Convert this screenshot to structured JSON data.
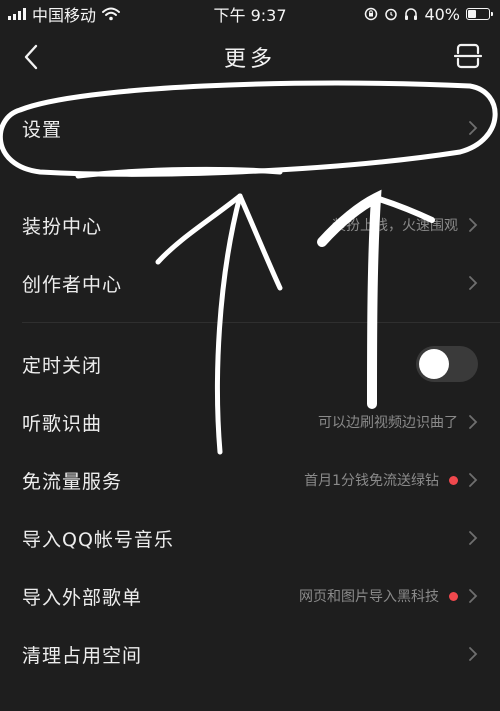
{
  "status_bar": {
    "carrier": "中国移动",
    "time": "下午 9:37",
    "battery": "40%",
    "battery_level": 0.4
  },
  "nav": {
    "title": "更多",
    "back_icon": "chevron-left-icon",
    "right_icon": "scan-icon"
  },
  "items": [
    {
      "label": "设置",
      "hint": "",
      "dot": false
    },
    {
      "label": "装扮中心",
      "hint": "装扮上线，火速围观",
      "dot": false
    },
    {
      "label": "创作者中心",
      "hint": "",
      "dot": false
    },
    {
      "label": "定时关闭",
      "toggle": false
    },
    {
      "label": "听歌识曲",
      "hint": "可以边刷视频边识曲了",
      "dot": false
    },
    {
      "label": "免流量服务",
      "hint": "首月1分钱免流送绿钻",
      "dot": true
    },
    {
      "label": "导入QQ帐号音乐",
      "hint": "",
      "dot": false
    },
    {
      "label": "导入外部歌单",
      "hint": "网页和图片导入黑科技",
      "dot": true
    },
    {
      "label": "清理占用空间",
      "hint": "",
      "dot": false
    }
  ],
  "colors": {
    "background": "#1e1e1e",
    "text": "#ededed",
    "hint": "#8a8a8a",
    "dot": "#f0484d",
    "annotation": "#ffffff"
  }
}
